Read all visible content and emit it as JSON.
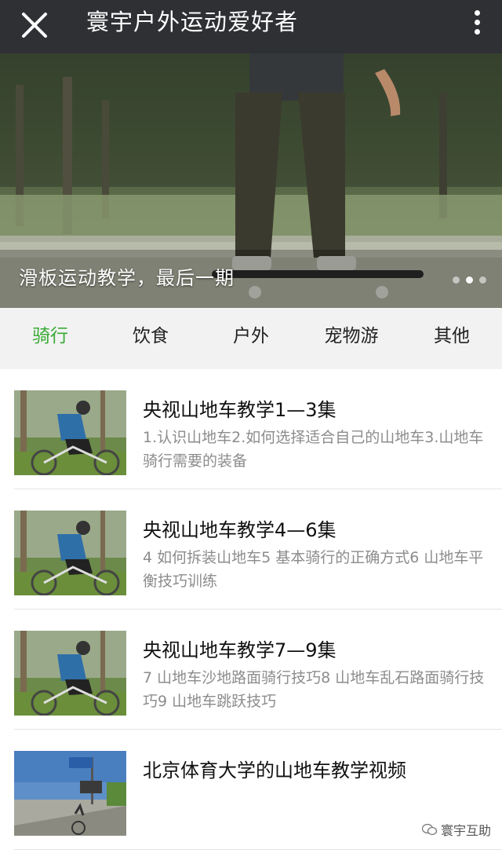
{
  "header": {
    "title": "寰宇户外运动爱好者",
    "close_icon": "close-icon",
    "more_icon": "more-vertical-icon"
  },
  "banner": {
    "caption": "滑板运动教学，最后一期",
    "slides_total": 3,
    "active_slide": 3
  },
  "tabs": [
    {
      "label": "骑行",
      "active": true
    },
    {
      "label": "饮食",
      "active": false
    },
    {
      "label": "户外",
      "active": false
    },
    {
      "label": "宠物游",
      "active": false
    },
    {
      "label": "其他",
      "active": false
    }
  ],
  "articles": [
    {
      "title": "央视山地车教学1—3集",
      "desc": "1.认识山地车2.如何选择适合自己的山地车3.山地车骑行需要的装备",
      "thumb": "cyclist-forest"
    },
    {
      "title": "央视山地车教学4—6集",
      "desc": "4 如何拆装山地车5 基本骑行的正确方式6 山地车平衡技巧训练",
      "thumb": "cyclist-forest"
    },
    {
      "title": "央视山地车教学7—9集",
      "desc": "7 山地车沙地路面骑行技巧8 山地车乱石路面骑行技巧9 山地车跳跃技巧",
      "thumb": "cyclist-forest"
    },
    {
      "title": "北京体育大学的山地车教学视频",
      "desc": "",
      "thumb": "road-sign"
    }
  ],
  "watermark": "寰宇互助",
  "colors": {
    "accent": "#3aaa35",
    "topbar": "#2e3034",
    "tabbar": "#f2f2f2"
  }
}
